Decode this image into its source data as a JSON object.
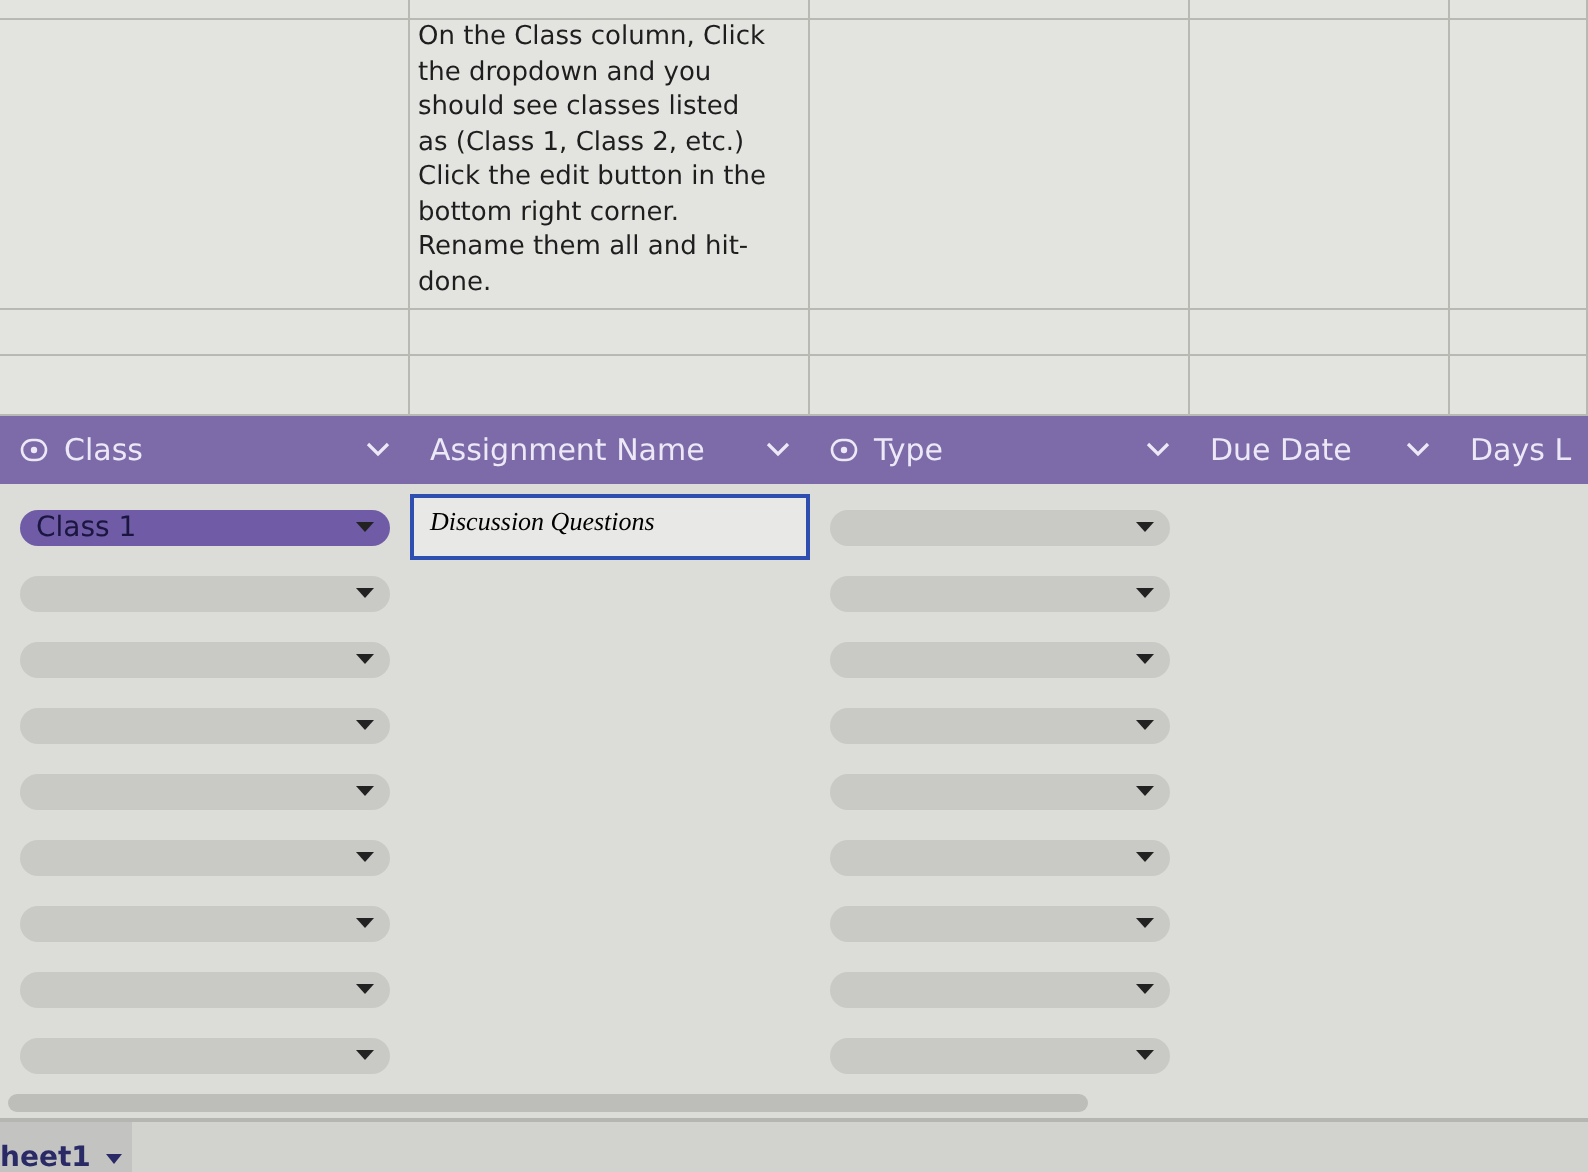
{
  "instructions": {
    "text": "On the Class column, Click the dropdown and you should see classes listed as (Class 1, Class 2, etc.) Click the edit button in the bottom right corner. Rename them all and hit-done."
  },
  "columns": [
    {
      "label": "Class",
      "kind": "dropdown"
    },
    {
      "label": "Assignment Name",
      "kind": "text"
    },
    {
      "label": "Type",
      "kind": "dropdown"
    },
    {
      "label": "Due Date",
      "kind": "date"
    },
    {
      "label": "Days L",
      "kind": "cut"
    }
  ],
  "rows": [
    {
      "class": "Class 1",
      "assignment": "Discussion Questions"
    },
    {},
    {},
    {},
    {},
    {},
    {},
    {},
    {}
  ],
  "sheet_tab": {
    "label": "heet1"
  }
}
